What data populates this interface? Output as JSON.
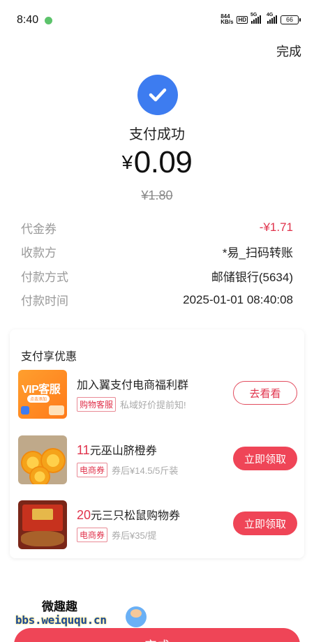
{
  "status_bar": {
    "time": "8:40",
    "net_speed_value": "844",
    "net_speed_unit": "KB/s",
    "hd_label": "HD",
    "network_5g": "5G",
    "network_4g": "4G",
    "battery": "66"
  },
  "header": {
    "done_label": "完成"
  },
  "result": {
    "title": "支付成功",
    "currency": "¥",
    "amount": "0.09",
    "original_amount": "¥1.80",
    "accent_color": "#3d7cf0"
  },
  "details": [
    {
      "label": "代金券",
      "value": "-¥1.71"
    },
    {
      "label": "收款方",
      "value": "*易_扫码转账"
    },
    {
      "label": "付款方式",
      "value": "邮储银行(5634)"
    },
    {
      "label": "付款时间",
      "value": "2025-01-01 08:40:08"
    }
  ],
  "promo": {
    "header": "支付享优惠",
    "items": [
      {
        "thumb_text": "VIP客服",
        "thumb_sub": "点击添加",
        "number": "",
        "title": "加入翼支付电商福利群",
        "tag": "购物客服",
        "desc": "私域好价提前知!",
        "button": "去看看"
      },
      {
        "number": "11",
        "title": "元巫山脐橙券",
        "tag": "电商券",
        "desc": "券后¥14.5/5斤装",
        "button": "立即领取"
      },
      {
        "number": "20",
        "title": "元三只松鼠购物券",
        "tag": "电商券",
        "desc": "券后¥35/提",
        "button": "立即领取"
      }
    ]
  },
  "watermark": {
    "top": "微趣趣",
    "bottom": "bbs.weiququ.cn"
  },
  "bottom_button": "完成",
  "colors": {
    "brand_red": "#ef4557",
    "check_blue": "#3d7cf0"
  }
}
